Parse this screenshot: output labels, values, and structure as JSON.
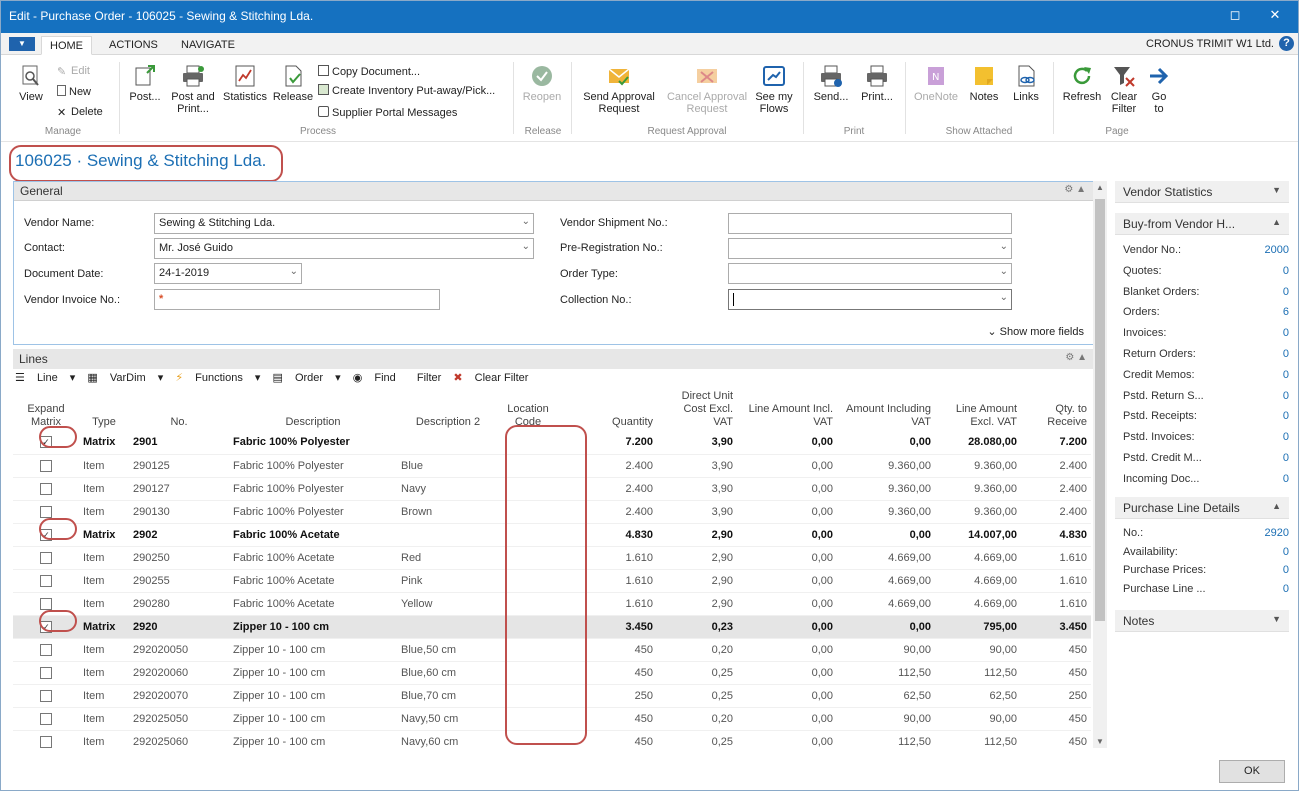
{
  "window": {
    "title": "Edit - Purchase Order - 106025 - Sewing & Stitching Lda."
  },
  "menu": {
    "tabs": [
      "HOME",
      "ACTIONS",
      "NAVIGATE"
    ],
    "company": "CRONUS TRIMIT W1 Ltd.",
    "help": "?"
  },
  "ribbon": {
    "manage": {
      "view": "View",
      "edit": "Edit",
      "new": "New",
      "delete": "Delete",
      "group": "Manage"
    },
    "process": {
      "post": "Post...",
      "post_print": [
        "Post and",
        "Print..."
      ],
      "statistics": "Statistics",
      "release": "Release",
      "copy_document": "Copy Document...",
      "create_inventory": "Create Inventory Put-away/Pick...",
      "supplier_portal": "Supplier Portal Messages",
      "group": "Process"
    },
    "release": {
      "reopen": "Reopen",
      "group": "Release"
    },
    "approval": {
      "send": [
        "Send Approval",
        "Request"
      ],
      "cancel": [
        "Cancel Approval",
        "Request"
      ],
      "flows": [
        "See my",
        "Flows"
      ],
      "group": "Request Approval"
    },
    "print": {
      "send": "Send...",
      "print": "Print...",
      "group": "Print"
    },
    "attached": {
      "onenote": "OneNote",
      "notes": "Notes",
      "links": "Links",
      "group": "Show Attached"
    },
    "page": {
      "refresh": "Refresh",
      "clear_filter": [
        "Clear",
        "Filter"
      ],
      "goto": [
        "Go",
        "to"
      ],
      "group": "Page"
    }
  },
  "page": {
    "title": "106025 · Sewing & Stitching Lda."
  },
  "general": {
    "header": "General",
    "vendor_name": {
      "label": "Vendor Name:",
      "value": "Sewing & Stitching Lda."
    },
    "contact": {
      "label": "Contact:",
      "value": "Mr. José Guido"
    },
    "document_date": {
      "label": "Document Date:",
      "value": "24-1-2019"
    },
    "vendor_invoice": {
      "label": "Vendor Invoice No.:",
      "value": "*"
    },
    "vendor_shipment": {
      "label": "Vendor Shipment No.:",
      "value": ""
    },
    "pre_registration": {
      "label": "Pre-Registration No.:",
      "value": ""
    },
    "order_type": {
      "label": "Order Type:",
      "value": ""
    },
    "collection": {
      "label": "Collection No.:",
      "value": ""
    },
    "show_more": "Show more fields"
  },
  "lines": {
    "header": "Lines",
    "toolbar": [
      "Line",
      "VarDim",
      "Functions",
      "Order",
      "Find",
      "Filter",
      "Clear Filter"
    ],
    "columns": [
      "Expand Matrix",
      "Type",
      "No.",
      "Description",
      "Description 2",
      "Location Code",
      "Quantity",
      "Direct Unit Cost Excl. VAT",
      "Line Amount Incl. VAT",
      "Amount Including VAT",
      "Line Amount Excl. VAT",
      "Qty. to Receive"
    ],
    "rows": [
      {
        "expand": true,
        "type": "Matrix",
        "no": "2901",
        "desc": "Fabric 100% Polyester",
        "desc2": "",
        "loc": "",
        "qty": "7.200",
        "cost": "3,90",
        "lincl": "0,00",
        "aincl": "0,00",
        "lexcl": "28.080,00",
        "recv": "7.200",
        "bold": true,
        "sel": false
      },
      {
        "expand": false,
        "type": "Item",
        "no": "290125",
        "desc": "Fabric 100% Polyester",
        "desc2": "Blue",
        "loc": "",
        "qty": "2.400",
        "cost": "3,90",
        "lincl": "0,00",
        "aincl": "9.360,00",
        "lexcl": "9.360,00",
        "recv": "2.400",
        "bold": false,
        "sel": false
      },
      {
        "expand": false,
        "type": "Item",
        "no": "290127",
        "desc": "Fabric 100% Polyester",
        "desc2": "Navy",
        "loc": "",
        "qty": "2.400",
        "cost": "3,90",
        "lincl": "0,00",
        "aincl": "9.360,00",
        "lexcl": "9.360,00",
        "recv": "2.400",
        "bold": false,
        "sel": false
      },
      {
        "expand": false,
        "type": "Item",
        "no": "290130",
        "desc": "Fabric 100% Polyester",
        "desc2": "Brown",
        "loc": "",
        "qty": "2.400",
        "cost": "3,90",
        "lincl": "0,00",
        "aincl": "9.360,00",
        "lexcl": "9.360,00",
        "recv": "2.400",
        "bold": false,
        "sel": false
      },
      {
        "expand": true,
        "type": "Matrix",
        "no": "2902",
        "desc": "Fabric 100% Acetate",
        "desc2": "",
        "loc": "",
        "qty": "4.830",
        "cost": "2,90",
        "lincl": "0,00",
        "aincl": "0,00",
        "lexcl": "14.007,00",
        "recv": "4.830",
        "bold": true,
        "sel": false
      },
      {
        "expand": false,
        "type": "Item",
        "no": "290250",
        "desc": "Fabric 100% Acetate",
        "desc2": "Red",
        "loc": "",
        "qty": "1.610",
        "cost": "2,90",
        "lincl": "0,00",
        "aincl": "4.669,00",
        "lexcl": "4.669,00",
        "recv": "1.610",
        "bold": false,
        "sel": false
      },
      {
        "expand": false,
        "type": "Item",
        "no": "290255",
        "desc": "Fabric 100% Acetate",
        "desc2": "Pink",
        "loc": "",
        "qty": "1.610",
        "cost": "2,90",
        "lincl": "0,00",
        "aincl": "4.669,00",
        "lexcl": "4.669,00",
        "recv": "1.610",
        "bold": false,
        "sel": false
      },
      {
        "expand": false,
        "type": "Item",
        "no": "290280",
        "desc": "Fabric 100% Acetate",
        "desc2": "Yellow",
        "loc": "",
        "qty": "1.610",
        "cost": "2,90",
        "lincl": "0,00",
        "aincl": "4.669,00",
        "lexcl": "4.669,00",
        "recv": "1.610",
        "bold": false,
        "sel": false
      },
      {
        "expand": true,
        "type": "Matrix",
        "no": "2920",
        "desc": "Zipper 10 - 100 cm",
        "desc2": "",
        "loc": "",
        "qty": "3.450",
        "cost": "0,23",
        "lincl": "0,00",
        "aincl": "0,00",
        "lexcl": "795,00",
        "recv": "3.450",
        "bold": true,
        "sel": true
      },
      {
        "expand": false,
        "type": "Item",
        "no": "292020050",
        "desc": "Zipper 10 - 100 cm",
        "desc2": "Blue,50 cm",
        "loc": "",
        "qty": "450",
        "cost": "0,20",
        "lincl": "0,00",
        "aincl": "90,00",
        "lexcl": "90,00",
        "recv": "450",
        "bold": false,
        "sel": false
      },
      {
        "expand": false,
        "type": "Item",
        "no": "292020060",
        "desc": "Zipper 10 - 100 cm",
        "desc2": "Blue,60 cm",
        "loc": "",
        "qty": "450",
        "cost": "0,25",
        "lincl": "0,00",
        "aincl": "112,50",
        "lexcl": "112,50",
        "recv": "450",
        "bold": false,
        "sel": false
      },
      {
        "expand": false,
        "type": "Item",
        "no": "292020070",
        "desc": "Zipper 10 - 100 cm",
        "desc2": "Blue,70 cm",
        "loc": "",
        "qty": "250",
        "cost": "0,25",
        "lincl": "0,00",
        "aincl": "62,50",
        "lexcl": "62,50",
        "recv": "250",
        "bold": false,
        "sel": false
      },
      {
        "expand": false,
        "type": "Item",
        "no": "292025050",
        "desc": "Zipper 10 - 100 cm",
        "desc2": "Navy,50 cm",
        "loc": "",
        "qty": "450",
        "cost": "0,20",
        "lincl": "0,00",
        "aincl": "90,00",
        "lexcl": "90,00",
        "recv": "450",
        "bold": false,
        "sel": false
      },
      {
        "expand": false,
        "type": "Item",
        "no": "292025060",
        "desc": "Zipper 10 - 100 cm",
        "desc2": "Navy,60 cm",
        "loc": "",
        "qty": "450",
        "cost": "0,25",
        "lincl": "0,00",
        "aincl": "112,50",
        "lexcl": "112,50",
        "recv": "450",
        "bold": false,
        "sel": false
      }
    ]
  },
  "factbox": {
    "vendor_statistics": "Vendor Statistics",
    "buy_from": {
      "title": "Buy-from Vendor H...",
      "rows": [
        {
          "label": "Vendor No.:",
          "value": "2000"
        },
        {
          "label": "Quotes:",
          "value": "0"
        },
        {
          "label": "Blanket Orders:",
          "value": "0"
        },
        {
          "label": "Orders:",
          "value": "6"
        },
        {
          "label": "Invoices:",
          "value": "0"
        },
        {
          "label": "Return Orders:",
          "value": "0"
        },
        {
          "label": "Credit Memos:",
          "value": "0"
        },
        {
          "label": "Pstd. Return S...",
          "value": "0"
        },
        {
          "label": "Pstd. Receipts:",
          "value": "0"
        },
        {
          "label": "Pstd. Invoices:",
          "value": "0"
        },
        {
          "label": "Pstd. Credit M...",
          "value": "0"
        },
        {
          "label": "Incoming Doc...",
          "value": "0"
        }
      ]
    },
    "purchase_line": {
      "title": "Purchase Line Details",
      "rows": [
        {
          "label": "No.:",
          "value": "2920"
        },
        {
          "label": "Availability:",
          "value": "0"
        },
        {
          "label": "Purchase Prices:",
          "value": "0"
        },
        {
          "label": "Purchase Line ...",
          "value": "0"
        }
      ]
    },
    "notes": "Notes"
  },
  "footer": {
    "ok": "OK"
  },
  "colors": {
    "title_bar": "#1571c0",
    "accent": "#1c6fb4",
    "highlight": "#c0504d"
  }
}
